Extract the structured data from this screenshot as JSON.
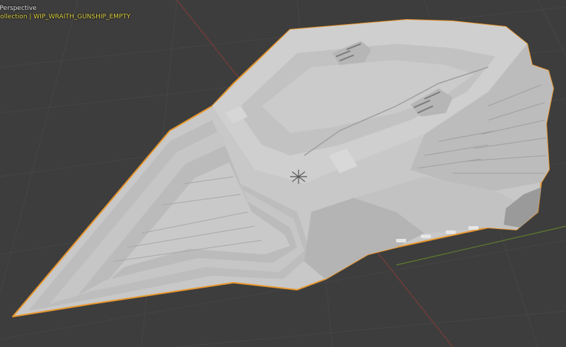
{
  "viewport": {
    "view_name": "User Perspective",
    "view_name_visible": "r Perspective",
    "collection_line_visible": "Collection | WIP_WRAITH_GUNSHIP_EMPTY",
    "colors": {
      "background": "#3d3d3d",
      "grid_line": "#444444",
      "axis_x": "#8b3a3a",
      "axis_y": "#6d8b2f",
      "object_fill": "#c9c9c9",
      "object_shadow": "#a6a6a6",
      "selection_outline": "#e8972e",
      "collection_text": "#e7d84a",
      "view_text": "#e8e8e8"
    },
    "icons": [
      "origin-empty-icon"
    ]
  }
}
